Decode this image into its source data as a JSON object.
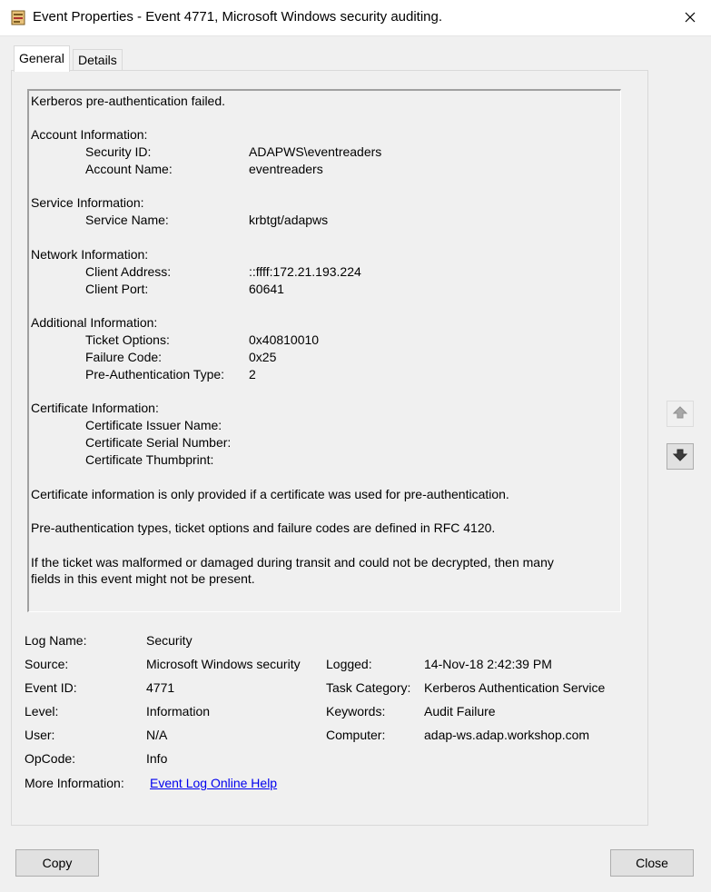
{
  "window": {
    "title": "Event Properties - Event 4771, Microsoft Windows security auditing.",
    "icon": "event-viewer-icon",
    "close_icon": "close-icon"
  },
  "tabs": [
    {
      "label": "General",
      "active": true
    },
    {
      "label": "Details",
      "active": false
    }
  ],
  "description": {
    "summary": "Kerberos pre-authentication failed.",
    "account_header": "Account Information:",
    "security_id_label": "Security ID:",
    "security_id_value": "ADAPWS\\eventreaders",
    "account_name_label": "Account Name:",
    "account_name_value": "eventreaders",
    "service_header": "Service Information:",
    "service_name_label": "Service Name:",
    "service_name_value": "krbtgt/adapws",
    "network_header": "Network Information:",
    "client_address_label": "Client Address:",
    "client_address_value": "::ffff:172.21.193.224",
    "client_port_label": "Client Port:",
    "client_port_value": "60641",
    "additional_header": "Additional Information:",
    "ticket_options_label": "Ticket Options:",
    "ticket_options_value": "0x40810010",
    "failure_code_label": "Failure Code:",
    "failure_code_value": "0x25",
    "preauth_type_label": "Pre-Authentication Type:",
    "preauth_type_value": "2",
    "certificate_header": "Certificate Information:",
    "cert_issuer_label": "Certificate Issuer Name:",
    "cert_serial_label": "Certificate Serial Number:",
    "cert_thumbprint_label": "Certificate Thumbprint:",
    "note1": "Certificate information is only provided if a certificate was used for pre-authentication.",
    "note2": "Pre-authentication types, ticket options and failure codes are defined in RFC 4120.",
    "note3_line1": "If the ticket was malformed or damaged during transit and could not be decrypted, then many",
    "note3_line2": "fields in this event might not be present."
  },
  "scroll": {
    "up_icon": "arrow-up-icon",
    "down_icon": "arrow-down-icon"
  },
  "meta": {
    "log_name_label": "Log Name:",
    "log_name_value": "Security",
    "source_label": "Source:",
    "source_value": "Microsoft Windows security",
    "logged_label": "Logged:",
    "logged_value": "14-Nov-18 2:42:39 PM",
    "event_id_label": "Event ID:",
    "event_id_value": "4771",
    "task_category_label": "Task Category:",
    "task_category_value": "Kerberos Authentication Service",
    "level_label": "Level:",
    "level_value": "Information",
    "keywords_label": "Keywords:",
    "keywords_value": "Audit Failure",
    "user_label": "User:",
    "user_value": "N/A",
    "computer_label": "Computer:",
    "computer_value": "adap-ws.adap.workshop.com",
    "opcode_label": "OpCode:",
    "opcode_value": "Info",
    "more_info_label": "More Information:",
    "more_info_link": "Event Log Online Help"
  },
  "buttons": {
    "copy": "Copy",
    "close": "Close"
  },
  "colors": {
    "window_bg": "#f0f0f0",
    "link": "#0000ee",
    "button_bg": "#e1e1e1"
  }
}
